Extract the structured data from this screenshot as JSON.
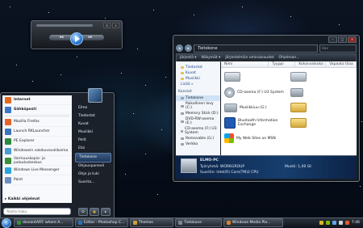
{
  "media_player": {
    "prev_label": "◂◂",
    "next_label": "▸▸",
    "window_controls": [
      "⊡",
      "×"
    ]
  },
  "explorer": {
    "window_controls": [
      "–",
      "□",
      "×"
    ],
    "address": "Tietokone",
    "search_placeholder": "Hae",
    "commands": [
      "Järjestä ▾",
      "Näkymät ▾",
      "Järjestelmän ominaisuudet",
      "Ohjelman..."
    ],
    "favorites": [
      "Tiedostot",
      "Kuvat",
      "Musiikki",
      "Lisää »"
    ],
    "folders_label": "Kansiot",
    "tree": [
      "Tietokone",
      "Paikallinen levy (C:)",
      "Memory Stick (D:)",
      "DVD-RW-asema (E:)",
      "CD-asema (F:) U3 System",
      "Removable (G:)",
      "Verkko"
    ],
    "columns": [
      "Nimi",
      "Tyyppi",
      "Kokonaiskoko",
      "Vapaata tilaa"
    ],
    "items": [
      {
        "label": "",
        "icon": "hard-drive"
      },
      {
        "label": "",
        "icon": "hard-drive"
      },
      {
        "label": "CD-asema (F:) U3 System",
        "icon": "disc"
      },
      {
        "label": "",
        "icon": "removable"
      },
      {
        "label": "Musiikkiuu (G:)",
        "icon": "removable"
      },
      {
        "label": "",
        "icon": "folder"
      },
      {
        "label": "Bluetooth Information Exchange",
        "icon": "bluetooth"
      },
      {
        "label": "",
        "icon": "folder"
      },
      {
        "label": "My Web Sites on MSN",
        "icon": "msn"
      }
    ],
    "details": {
      "name": "ELMO-PC",
      "workgroup": "Työryhmä: WORKGROUP",
      "processor": "Suoritin: Intel(R) Core(TM)2 CPU",
      "memory": "Muisti: 1,00 Gt"
    }
  },
  "start_menu": {
    "programs": [
      {
        "label": "Internet",
        "color": "#e2691f"
      },
      {
        "label": "Sähköposti",
        "color": "#3c76c9"
      },
      {
        "label": "Mozilla Firefox",
        "color": "#e8632a"
      },
      {
        "label": "Launch RKLauncher",
        "color": "#3e74b8"
      },
      {
        "label": "PE Explorer",
        "color": "#2b8a3e"
      },
      {
        "label": "Windowsin valokuvavalikoima",
        "color": "#4a9bd6"
      },
      {
        "label": "Varmuuskopio- ja palautuskeskus",
        "color": "#3b8f3b"
      },
      {
        "label": "Windows Live Messenger",
        "color": "#2aa4dc"
      },
      {
        "label": "Paint",
        "color": "#6c8fc2"
      }
    ],
    "all_programs": "Kaikki ohjelmat",
    "search_placeholder": "Aloita haku",
    "right_items": [
      "Elmo",
      "Tiedostot",
      "Kuvat",
      "Musiikki",
      "Pelit",
      "Etsi",
      "Tietokone",
      "Ohjauspaneeli",
      "Ohje ja tuki",
      "Suorita..."
    ],
    "power_buttons": [
      "⏻",
      "🔒",
      "▸"
    ]
  },
  "taskbar": {
    "buttons": [
      {
        "label": "deviantART: where A...",
        "color": "#3b8f3b"
      },
      {
        "label": "Editor - Photoshop C...",
        "color": "#2d6fb8"
      },
      {
        "label": "Themes",
        "color": "#c9a13a"
      },
      {
        "label": "Tietokone",
        "color": "#7b8796"
      },
      {
        "label": "Windows Media Pla...",
        "color": "#d9822b"
      }
    ],
    "clock": "7:46"
  }
}
